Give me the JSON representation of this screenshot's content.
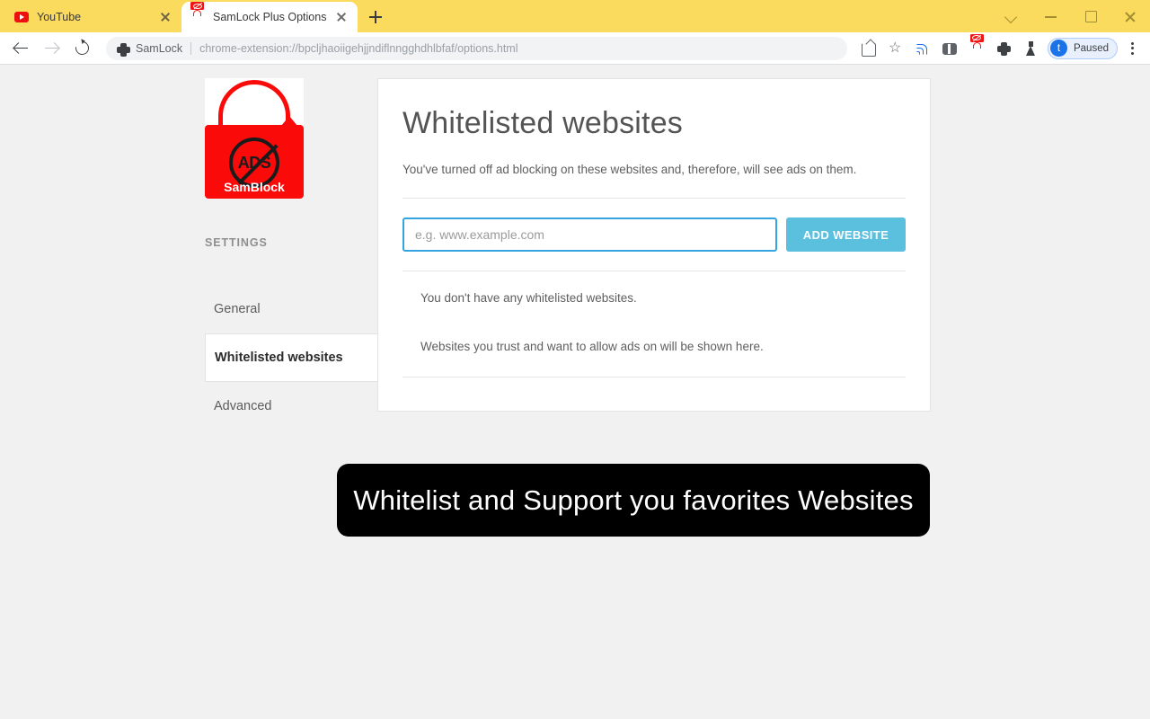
{
  "browser": {
    "tabs": [
      {
        "title": "YouTube",
        "favicon": "youtube-icon",
        "active": false
      },
      {
        "title": "SamLock Plus Options",
        "favicon": "samblock-lock-icon",
        "active": true
      }
    ],
    "new_tab_label": "+",
    "window_controls": [
      "tab-search-chevron",
      "minimize",
      "maximize",
      "close"
    ],
    "nav": {
      "back": "back-arrow",
      "forward": "forward-arrow",
      "reload": "reload-icon"
    },
    "omnibox": {
      "scheme_label": "SamLock",
      "url": "chrome-extension://bpcljhaoiigehjjndiflnngghdhlbfaf/options.html",
      "icon": "extension-puzzle-icon"
    },
    "toolbar_icons": [
      "share-icon",
      "bookmark-star-icon",
      "cast-icon",
      "side-panel-icon",
      "samblock-extension-icon",
      "extensions-puzzle-icon",
      "experiments-flask-icon"
    ],
    "profile": {
      "initial": "t",
      "status": "Paused"
    },
    "menu_icon": "three-dot-menu-icon",
    "accent_blue": "#1a73e8",
    "tabstrip_color": "#fbdb5e"
  },
  "page": {
    "logo": {
      "name": "SamBlock",
      "badge_text": "ADS",
      "icon": "open-padlock-no-ads-icon",
      "color": "#fb0a0a"
    },
    "sidebar": {
      "heading": "SETTINGS",
      "items": [
        {
          "label": "General",
          "active": false
        },
        {
          "label": "Whitelisted websites",
          "active": true
        },
        {
          "label": "Advanced",
          "active": false
        }
      ]
    },
    "card": {
      "title": "Whitelisted websites",
      "description": "You've turned off ad blocking on these websites and, therefore, will see ads on them.",
      "input_placeholder": "e.g. www.example.com",
      "input_value": "",
      "add_button": "ADD WEBSITE",
      "add_button_color": "#5bc0de",
      "input_focus_color": "#35a5df",
      "empty_primary": "You don't have any whitelisted websites.",
      "empty_secondary": "Websites you trust and want to allow ads on will be shown here."
    },
    "caption": "Whitelist and Support you favorites Websites"
  }
}
